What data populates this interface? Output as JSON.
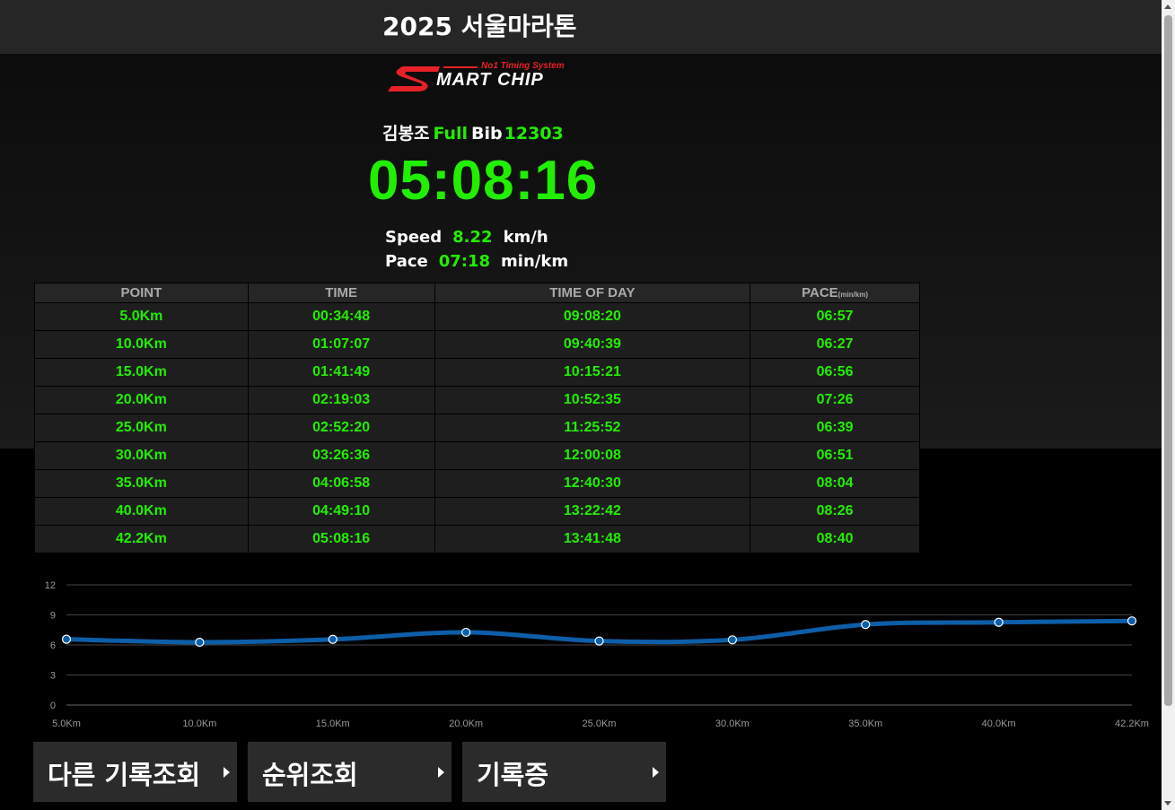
{
  "header": {
    "title": "2025 서울마라톤"
  },
  "logo": {
    "tagline": "No1 Timing System",
    "brand": "MART CHIP",
    "brand_initial": "S"
  },
  "runner": {
    "name": "김봉조",
    "category": "Full",
    "bib_label": "Bib",
    "bib_number": "12303"
  },
  "finish_time": "05:08:16",
  "stats": {
    "speed_label": "Speed",
    "speed_value": "8.22",
    "speed_unit": "km/h",
    "pace_label": "Pace",
    "pace_value": "07:18",
    "pace_unit": "min/km"
  },
  "table": {
    "headers": {
      "point": "POINT",
      "time": "TIME",
      "time_of_day": "TIME OF DAY",
      "pace": "PACE",
      "pace_unit": "(min/km)"
    },
    "rows": [
      {
        "point": "5.0Km",
        "time": "00:34:48",
        "tod": "09:08:20",
        "pace": "06:57"
      },
      {
        "point": "10.0Km",
        "time": "01:07:07",
        "tod": "09:40:39",
        "pace": "06:27"
      },
      {
        "point": "15.0Km",
        "time": "01:41:49",
        "tod": "10:15:21",
        "pace": "06:56"
      },
      {
        "point": "20.0Km",
        "time": "02:19:03",
        "tod": "10:52:35",
        "pace": "07:26"
      },
      {
        "point": "25.0Km",
        "time": "02:52:20",
        "tod": "11:25:52",
        "pace": "06:39"
      },
      {
        "point": "30.0Km",
        "time": "03:26:36",
        "tod": "12:00:08",
        "pace": "06:51"
      },
      {
        "point": "35.0Km",
        "time": "04:06:58",
        "tod": "12:40:30",
        "pace": "08:04"
      },
      {
        "point": "40.0Km",
        "time": "04:49:10",
        "tod": "13:22:42",
        "pace": "08:26"
      },
      {
        "point": "42.2Km",
        "time": "05:08:16",
        "tod": "13:41:48",
        "pace": "08:40"
      }
    ]
  },
  "chart_data": {
    "type": "line",
    "categories": [
      "5.0Km",
      "10.0Km",
      "15.0Km",
      "20.0Km",
      "25.0Km",
      "30.0Km",
      "35.0Km",
      "40.0Km",
      "42.2Km"
    ],
    "series": [
      {
        "values": [
          6.57,
          6.27,
          6.56,
          7.26,
          6.39,
          6.51,
          8.04,
          8.26,
          8.4
        ]
      }
    ],
    "yticks": [
      "0",
      "3",
      "6",
      "9",
      "12"
    ],
    "ylim": [
      0,
      12
    ],
    "grid": true,
    "line_color": "#0d5ea8"
  },
  "buttons": {
    "other_records": "다른 기록조회",
    "ranking": "순위조회",
    "certificate": "기록증"
  },
  "colors": {
    "accent": "#22ee00",
    "brand_red": "#e62128"
  }
}
